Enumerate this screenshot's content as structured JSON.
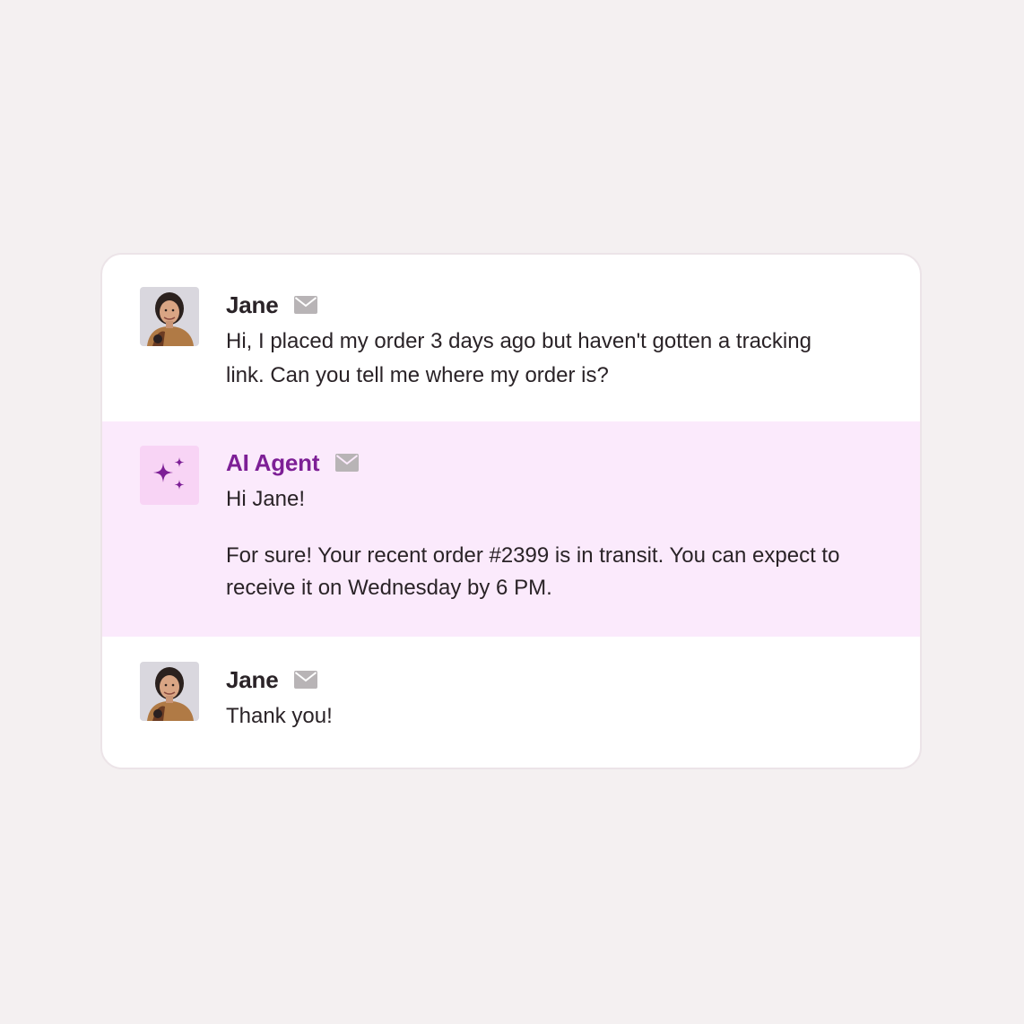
{
  "conversation": {
    "messages": [
      {
        "sender": "Jane",
        "channel_icon": "mail-icon",
        "text": "Hi, I placed my order 3 days ago but haven't gotten a tracking link. Can you tell me where my order is?"
      },
      {
        "sender": "AI Agent",
        "channel_icon": "mail-icon",
        "greeting": "Hi Jane!",
        "text": "For sure! Your recent order #2399 is in transit. You can expect to receive it on Wednesday by 6 PM."
      },
      {
        "sender": "Jane",
        "channel_icon": "mail-icon",
        "text": "Thank you!"
      }
    ]
  },
  "colors": {
    "background": "#f4f0f1",
    "card": "#ffffff",
    "agent_row": "#fbeafc",
    "agent_accent": "#7d1f96",
    "agent_icon_bg": "#f8d4f5",
    "mail_icon": "#b8b4b6"
  },
  "icons": {
    "agent_avatar": "sparkles-icon",
    "customer_avatar": "customer-avatar",
    "channel": "mail-icon"
  }
}
